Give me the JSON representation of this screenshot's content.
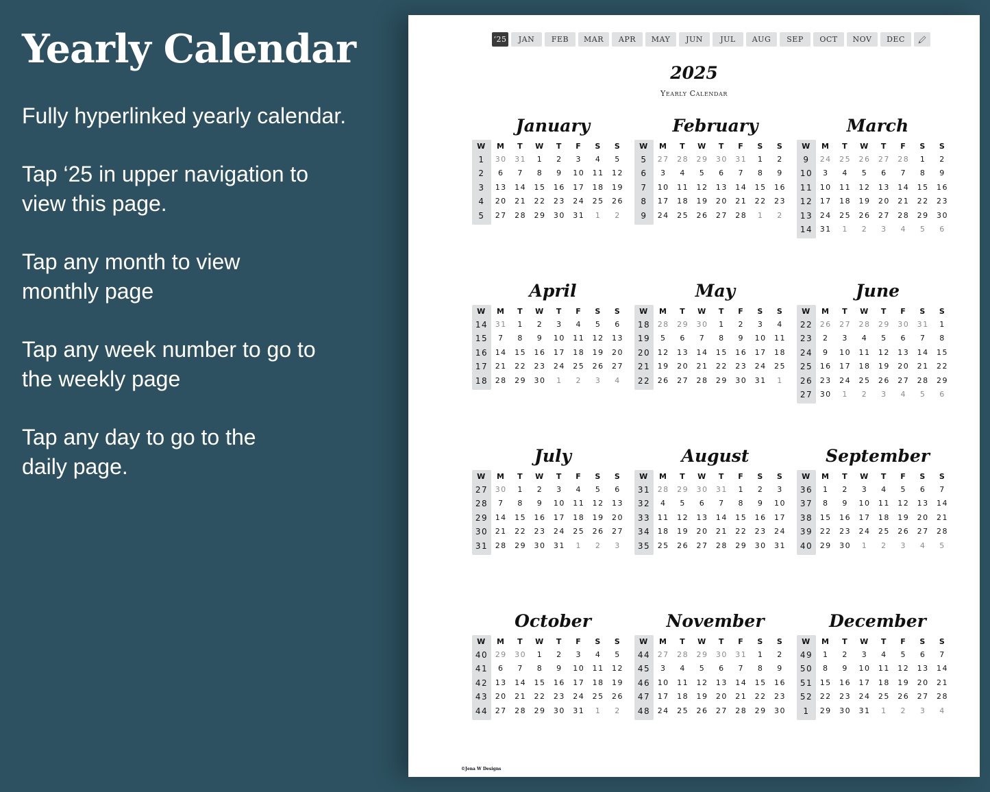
{
  "left_panel": {
    "title": "Yearly Calendar",
    "paragraphs": [
      "Fully hyperlinked yearly calendar.",
      "Tap ‘25 in upper navigation to\nview this page.",
      "Tap any month to view\nmonthly page",
      "Tap any week number to go to\nthe weekly page",
      "Tap any day to go to the\ndaily page."
    ]
  },
  "nav": {
    "year_tab": "‘25",
    "months": [
      "JAN",
      "FEB",
      "MAR",
      "APR",
      "MAY",
      "JUN",
      "JUL",
      "AUG",
      "SEP",
      "OCT",
      "NOV",
      "DEC"
    ],
    "edit_icon": "pencil-icon"
  },
  "header": {
    "year": "2025",
    "subtitle": "Yearly Calendar"
  },
  "weekday_headers": [
    "W",
    "M",
    "T",
    "W",
    "T",
    "F",
    "S",
    "S"
  ],
  "months": [
    {
      "name": "January",
      "weeks": [
        {
          "wk": "1",
          "days": [
            "30",
            "31",
            "1",
            "2",
            "3",
            "4",
            "5"
          ],
          "other": [
            0,
            1
          ]
        },
        {
          "wk": "2",
          "days": [
            "6",
            "7",
            "8",
            "9",
            "10",
            "11",
            "12"
          ],
          "other": []
        },
        {
          "wk": "3",
          "days": [
            "13",
            "14",
            "15",
            "16",
            "17",
            "18",
            "19"
          ],
          "other": []
        },
        {
          "wk": "4",
          "days": [
            "20",
            "21",
            "22",
            "23",
            "24",
            "25",
            "26"
          ],
          "other": []
        },
        {
          "wk": "5",
          "days": [
            "27",
            "28",
            "29",
            "30",
            "31",
            "1",
            "2"
          ],
          "other": [
            5,
            6
          ]
        }
      ]
    },
    {
      "name": "February",
      "weeks": [
        {
          "wk": "5",
          "days": [
            "27",
            "28",
            "29",
            "30",
            "31",
            "1",
            "2"
          ],
          "other": [
            0,
            1,
            2,
            3,
            4
          ]
        },
        {
          "wk": "6",
          "days": [
            "3",
            "4",
            "5",
            "6",
            "7",
            "8",
            "9"
          ],
          "other": []
        },
        {
          "wk": "7",
          "days": [
            "10",
            "11",
            "12",
            "13",
            "14",
            "15",
            "16"
          ],
          "other": []
        },
        {
          "wk": "8",
          "days": [
            "17",
            "18",
            "19",
            "20",
            "21",
            "22",
            "23"
          ],
          "other": []
        },
        {
          "wk": "9",
          "days": [
            "24",
            "25",
            "26",
            "27",
            "28",
            "1",
            "2"
          ],
          "other": [
            5,
            6
          ]
        }
      ]
    },
    {
      "name": "March",
      "weeks": [
        {
          "wk": "9",
          "days": [
            "24",
            "25",
            "26",
            "27",
            "28",
            "1",
            "2"
          ],
          "other": [
            0,
            1,
            2,
            3,
            4
          ]
        },
        {
          "wk": "10",
          "days": [
            "3",
            "4",
            "5",
            "6",
            "7",
            "8",
            "9"
          ],
          "other": []
        },
        {
          "wk": "11",
          "days": [
            "10",
            "11",
            "12",
            "13",
            "14",
            "15",
            "16"
          ],
          "other": []
        },
        {
          "wk": "12",
          "days": [
            "17",
            "18",
            "19",
            "20",
            "21",
            "22",
            "23"
          ],
          "other": []
        },
        {
          "wk": "13",
          "days": [
            "24",
            "25",
            "26",
            "27",
            "28",
            "29",
            "30"
          ],
          "other": []
        },
        {
          "wk": "14",
          "days": [
            "31",
            "1",
            "2",
            "3",
            "4",
            "5",
            "6"
          ],
          "other": [
            1,
            2,
            3,
            4,
            5,
            6
          ]
        }
      ]
    },
    {
      "name": "April",
      "weeks": [
        {
          "wk": "14",
          "days": [
            "31",
            "1",
            "2",
            "3",
            "4",
            "5",
            "6"
          ],
          "other": [
            0
          ]
        },
        {
          "wk": "15",
          "days": [
            "7",
            "8",
            "9",
            "10",
            "11",
            "12",
            "13"
          ],
          "other": []
        },
        {
          "wk": "16",
          "days": [
            "14",
            "15",
            "16",
            "17",
            "18",
            "19",
            "20"
          ],
          "other": []
        },
        {
          "wk": "17",
          "days": [
            "21",
            "22",
            "23",
            "24",
            "25",
            "26",
            "27"
          ],
          "other": []
        },
        {
          "wk": "18",
          "days": [
            "28",
            "29",
            "30",
            "1",
            "2",
            "3",
            "4"
          ],
          "other": [
            3,
            4,
            5,
            6
          ]
        }
      ]
    },
    {
      "name": "May",
      "weeks": [
        {
          "wk": "18",
          "days": [
            "28",
            "29",
            "30",
            "1",
            "2",
            "3",
            "4"
          ],
          "other": [
            0,
            1,
            2
          ]
        },
        {
          "wk": "19",
          "days": [
            "5",
            "6",
            "7",
            "8",
            "9",
            "10",
            "11"
          ],
          "other": []
        },
        {
          "wk": "20",
          "days": [
            "12",
            "13",
            "14",
            "15",
            "16",
            "17",
            "18"
          ],
          "other": []
        },
        {
          "wk": "21",
          "days": [
            "19",
            "20",
            "21",
            "22",
            "23",
            "24",
            "25"
          ],
          "other": []
        },
        {
          "wk": "22",
          "days": [
            "26",
            "27",
            "28",
            "29",
            "30",
            "31",
            "1"
          ],
          "other": [
            6
          ]
        }
      ]
    },
    {
      "name": "June",
      "weeks": [
        {
          "wk": "22",
          "days": [
            "26",
            "27",
            "28",
            "29",
            "30",
            "31",
            "1"
          ],
          "other": [
            0,
            1,
            2,
            3,
            4,
            5
          ]
        },
        {
          "wk": "23",
          "days": [
            "2",
            "3",
            "4",
            "5",
            "6",
            "7",
            "8"
          ],
          "other": []
        },
        {
          "wk": "24",
          "days": [
            "9",
            "10",
            "11",
            "12",
            "13",
            "14",
            "15"
          ],
          "other": []
        },
        {
          "wk": "25",
          "days": [
            "16",
            "17",
            "18",
            "19",
            "20",
            "21",
            "22"
          ],
          "other": []
        },
        {
          "wk": "26",
          "days": [
            "23",
            "24",
            "25",
            "26",
            "27",
            "28",
            "29"
          ],
          "other": []
        },
        {
          "wk": "27",
          "days": [
            "30",
            "1",
            "2",
            "3",
            "4",
            "5",
            "6"
          ],
          "other": [
            1,
            2,
            3,
            4,
            5,
            6
          ]
        }
      ]
    },
    {
      "name": "July",
      "weeks": [
        {
          "wk": "27",
          "days": [
            "30",
            "1",
            "2",
            "3",
            "4",
            "5",
            "6"
          ],
          "other": [
            0
          ]
        },
        {
          "wk": "28",
          "days": [
            "7",
            "8",
            "9",
            "10",
            "11",
            "12",
            "13"
          ],
          "other": []
        },
        {
          "wk": "29",
          "days": [
            "14",
            "15",
            "16",
            "17",
            "18",
            "19",
            "20"
          ],
          "other": []
        },
        {
          "wk": "30",
          "days": [
            "21",
            "22",
            "23",
            "24",
            "25",
            "26",
            "27"
          ],
          "other": []
        },
        {
          "wk": "31",
          "days": [
            "28",
            "29",
            "30",
            "31",
            "1",
            "2",
            "3"
          ],
          "other": [
            4,
            5,
            6
          ]
        }
      ]
    },
    {
      "name": "August",
      "weeks": [
        {
          "wk": "31",
          "days": [
            "28",
            "29",
            "30",
            "31",
            "1",
            "2",
            "3"
          ],
          "other": [
            0,
            1,
            2,
            3
          ]
        },
        {
          "wk": "32",
          "days": [
            "4",
            "5",
            "6",
            "7",
            "8",
            "9",
            "10"
          ],
          "other": []
        },
        {
          "wk": "33",
          "days": [
            "11",
            "12",
            "13",
            "14",
            "15",
            "16",
            "17"
          ],
          "other": []
        },
        {
          "wk": "34",
          "days": [
            "18",
            "19",
            "20",
            "21",
            "22",
            "23",
            "24"
          ],
          "other": []
        },
        {
          "wk": "35",
          "days": [
            "25",
            "26",
            "27",
            "28",
            "29",
            "30",
            "31"
          ],
          "other": []
        }
      ]
    },
    {
      "name": "September",
      "weeks": [
        {
          "wk": "36",
          "days": [
            "1",
            "2",
            "3",
            "4",
            "5",
            "6",
            "7"
          ],
          "other": []
        },
        {
          "wk": "37",
          "days": [
            "8",
            "9",
            "10",
            "11",
            "12",
            "13",
            "14"
          ],
          "other": []
        },
        {
          "wk": "38",
          "days": [
            "15",
            "16",
            "17",
            "18",
            "19",
            "20",
            "21"
          ],
          "other": []
        },
        {
          "wk": "39",
          "days": [
            "22",
            "23",
            "24",
            "25",
            "26",
            "27",
            "28"
          ],
          "other": []
        },
        {
          "wk": "40",
          "days": [
            "29",
            "30",
            "1",
            "2",
            "3",
            "4",
            "5"
          ],
          "other": [
            2,
            3,
            4,
            5,
            6
          ]
        }
      ]
    },
    {
      "name": "October",
      "weeks": [
        {
          "wk": "40",
          "days": [
            "29",
            "30",
            "1",
            "2",
            "3",
            "4",
            "5"
          ],
          "other": [
            0,
            1
          ]
        },
        {
          "wk": "41",
          "days": [
            "6",
            "7",
            "8",
            "9",
            "10",
            "11",
            "12"
          ],
          "other": []
        },
        {
          "wk": "42",
          "days": [
            "13",
            "14",
            "15",
            "16",
            "17",
            "18",
            "19"
          ],
          "other": []
        },
        {
          "wk": "43",
          "days": [
            "20",
            "21",
            "22",
            "23",
            "24",
            "25",
            "26"
          ],
          "other": []
        },
        {
          "wk": "44",
          "days": [
            "27",
            "28",
            "29",
            "30",
            "31",
            "1",
            "2"
          ],
          "other": [
            5,
            6
          ]
        }
      ]
    },
    {
      "name": "November",
      "weeks": [
        {
          "wk": "44",
          "days": [
            "27",
            "28",
            "29",
            "30",
            "31",
            "1",
            "2"
          ],
          "other": [
            0,
            1,
            2,
            3,
            4
          ]
        },
        {
          "wk": "45",
          "days": [
            "3",
            "4",
            "5",
            "6",
            "7",
            "8",
            "9"
          ],
          "other": []
        },
        {
          "wk": "46",
          "days": [
            "10",
            "11",
            "12",
            "13",
            "14",
            "15",
            "16"
          ],
          "other": []
        },
        {
          "wk": "47",
          "days": [
            "17",
            "18",
            "19",
            "20",
            "21",
            "22",
            "23"
          ],
          "other": []
        },
        {
          "wk": "48",
          "days": [
            "24",
            "25",
            "26",
            "27",
            "28",
            "29",
            "30"
          ],
          "other": []
        }
      ]
    },
    {
      "name": "December",
      "weeks": [
        {
          "wk": "49",
          "days": [
            "1",
            "2",
            "3",
            "4",
            "5",
            "6",
            "7"
          ],
          "other": []
        },
        {
          "wk": "50",
          "days": [
            "8",
            "9",
            "10",
            "11",
            "12",
            "13",
            "14"
          ],
          "other": []
        },
        {
          "wk": "51",
          "days": [
            "15",
            "16",
            "17",
            "18",
            "19",
            "20",
            "21"
          ],
          "other": []
        },
        {
          "wk": "52",
          "days": [
            "22",
            "23",
            "24",
            "25",
            "26",
            "27",
            "28"
          ],
          "other": []
        },
        {
          "wk": "1",
          "days": [
            "29",
            "30",
            "31",
            "1",
            "2",
            "3",
            "4"
          ],
          "other": [
            3,
            4,
            5,
            6
          ]
        }
      ]
    }
  ],
  "footer": "©Jena W Designs",
  "colors": {
    "background": "#2d5160",
    "nav_tab": "#e0e1e3",
    "nav_active": "#3a3a3a",
    "week_column": "#dedfe1",
    "other_month_text": "#8a8a8a"
  }
}
